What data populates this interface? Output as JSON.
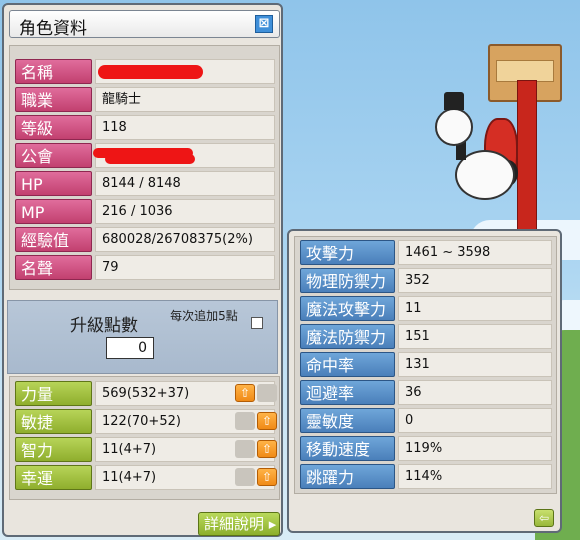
{
  "window": {
    "title": "角色資料",
    "close_glyph": "⊠"
  },
  "basic_info": [
    {
      "label": "名稱",
      "value": ""
    },
    {
      "label": "職業",
      "value": "龍騎士"
    },
    {
      "label": "等級",
      "value": "118"
    },
    {
      "label": "公會",
      "value": ""
    },
    {
      "label": "HP",
      "value": "8144 / 8148"
    },
    {
      "label": "MP",
      "value": "216 / 1036"
    },
    {
      "label": "經驗值",
      "value": "680028/26708375(2%)"
    },
    {
      "label": "名聲",
      "value": "79"
    }
  ],
  "ability_points": {
    "label": "升級點數",
    "value": "0",
    "note": "每次追加5點"
  },
  "stats": [
    {
      "label": "力量",
      "value": "569(532+37)"
    },
    {
      "label": "敏捷",
      "value": "122(70+52)"
    },
    {
      "label": "智力",
      "value": "11(4+7)"
    },
    {
      "label": "幸運",
      "value": "11(4+7)"
    }
  ],
  "detail_button": {
    "label": "詳細說明"
  },
  "detailed_stats": [
    {
      "label": "攻擊力",
      "value": "1461 ~ 3598"
    },
    {
      "label": "物理防禦力",
      "value": "352"
    },
    {
      "label": "魔法攻擊力",
      "value": "11"
    },
    {
      "label": "魔法防禦力",
      "value": "151"
    },
    {
      "label": "命中率",
      "value": "131"
    },
    {
      "label": "迴避率",
      "value": "36"
    },
    {
      "label": "靈敏度",
      "value": "0"
    },
    {
      "label": "移動速度",
      "value": "119%"
    },
    {
      "label": "跳躍力",
      "value": "114%"
    }
  ],
  "icons": {
    "up_arrow": "arrow-up-icon",
    "back_arrow": "arrow-back-icon",
    "close": "close-icon"
  },
  "colors": {
    "basic_label": "#c2406f",
    "stat_label": "#8fae2d",
    "detail_label": "#4a7fba",
    "up_button": "#f08a16",
    "redaction": "#ee1515"
  }
}
